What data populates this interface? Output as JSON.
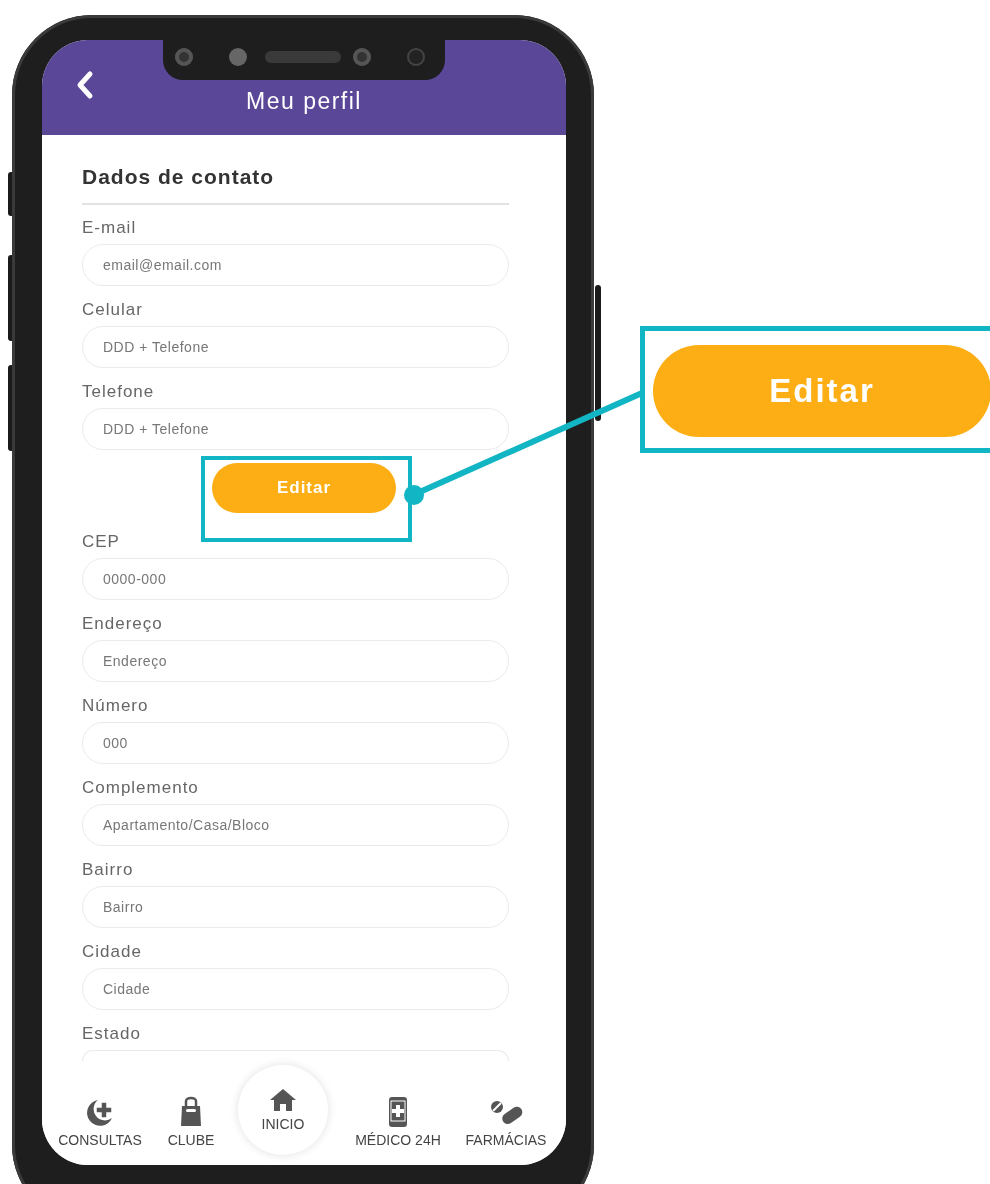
{
  "header": {
    "title": "Meu perfil"
  },
  "section": {
    "title": "Dados de contato"
  },
  "contact_fields": [
    {
      "label": "E-mail",
      "placeholder": "email@email.com"
    },
    {
      "label": "Celular",
      "placeholder": "DDD + Telefone"
    },
    {
      "label": "Telefone",
      "placeholder": "DDD + Telefone"
    }
  ],
  "edit_button": {
    "label": "Editar"
  },
  "address_fields": [
    {
      "label": "CEP",
      "placeholder": "0000-000"
    },
    {
      "label": "Endereço",
      "placeholder": "Endereço"
    },
    {
      "label": "Número",
      "placeholder": "000"
    },
    {
      "label": "Complemento",
      "placeholder": "Apartamento/Casa/Bloco"
    },
    {
      "label": "Bairro",
      "placeholder": "Bairro"
    },
    {
      "label": "Cidade",
      "placeholder": "Cidade"
    }
  ],
  "state_field": {
    "label": "Estado"
  },
  "nav": [
    {
      "kind": "medical",
      "label": "CONSULTAS",
      "selected": false
    },
    {
      "kind": "shop",
      "label": "CLUBE",
      "selected": false
    },
    {
      "kind": "home",
      "label": "INICIO",
      "selected": true
    },
    {
      "kind": "phone",
      "label": "MÉDICO 24H",
      "selected": false
    },
    {
      "kind": "pills",
      "label": "FARMÁCIAS",
      "selected": false
    }
  ],
  "callout": {
    "label": "Editar"
  }
}
